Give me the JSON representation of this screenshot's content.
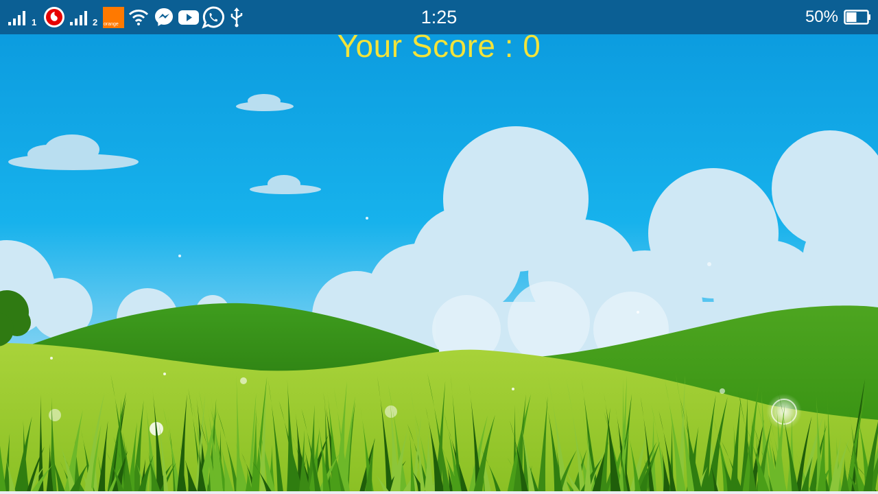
{
  "status_bar": {
    "sim1_index": "1",
    "sim2_index": "2",
    "carrier2_label": "orange",
    "time": "1:25",
    "battery_percent": "50%",
    "battery_level": 0.5,
    "icons": [
      "signal-sim1-icon",
      "vodafone-icon",
      "signal-sim2-icon",
      "orange-icon",
      "wifi-icon",
      "messenger-icon",
      "youtube-icon",
      "whatsapp-icon",
      "usb-icon",
      "battery-icon"
    ]
  },
  "game": {
    "score_text": "Your Score : 0"
  },
  "colors": {
    "status_bar_bg": "#0b5f94",
    "score_text": "#f2e33a",
    "sky_top": "#0a9fe0",
    "grass": "#7cc31e"
  }
}
